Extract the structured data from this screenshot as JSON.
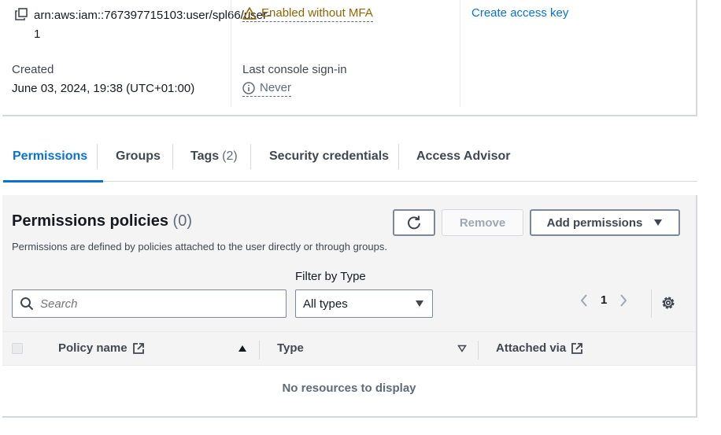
{
  "summary": {
    "arn": "arn:aws:iam::767397715103:user/spl66/user-1",
    "mfa_status": "Enabled without MFA",
    "access_key_link": "Create access key",
    "created_label": "Created",
    "created_value": "June 03, 2024, 19:38 (UTC+01:00)",
    "last_signin_label": "Last console sign-in",
    "last_signin_value": "Never"
  },
  "tabs": [
    {
      "label": "Permissions",
      "active": true
    },
    {
      "label": "Groups"
    },
    {
      "label": "Tags",
      "count": "(2)"
    },
    {
      "label": "Security credentials"
    },
    {
      "label": "Access Advisor"
    }
  ],
  "policies": {
    "title": "Permissions policies",
    "count": "(0)",
    "description": "Permissions are defined by policies attached to the user directly or through groups.",
    "remove_label": "Remove",
    "add_label": "Add permissions",
    "filter_label": "Filter by Type",
    "search_placeholder": "Search",
    "filter_value": "All types",
    "page": "1",
    "columns": [
      "Policy name",
      "Type",
      "Attached via"
    ],
    "empty_text": "No resources to display"
  },
  "colors": {
    "accent": "#0972d3",
    "warning": "#8d6605"
  },
  "icons": [
    "copy-icon",
    "warning-icon",
    "info-icon",
    "refresh-icon",
    "caret-down-icon",
    "search-icon",
    "chevron-left-icon",
    "chevron-right-icon",
    "gear-icon",
    "external-link-icon",
    "sort-ascending-icon",
    "sort-icon"
  ]
}
